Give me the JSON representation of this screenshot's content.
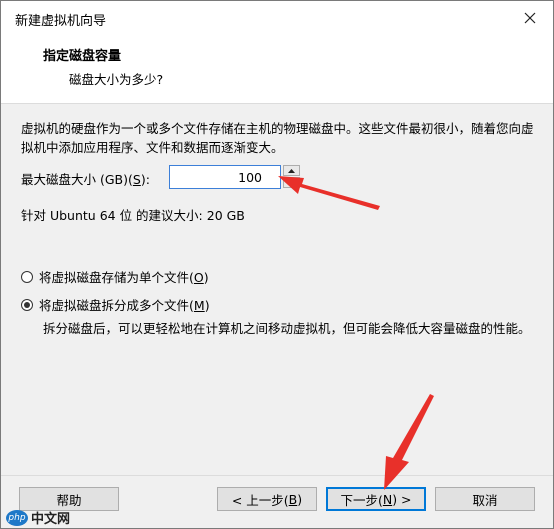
{
  "window": {
    "title": "新建虚拟机向导"
  },
  "header": {
    "title": "指定磁盘容量",
    "subtitle": "磁盘大小为多少?"
  },
  "description": "虚拟机的硬盘作为一个或多个文件存储在主机的物理磁盘中。这些文件最初很小，随着您向虚拟机中添加应用程序、文件和数据而逐渐变大。",
  "disk_size": {
    "label_prefix": "最大磁盘大小 (GB)(",
    "label_key": "S",
    "label_suffix": "):",
    "value": "100"
  },
  "recommend": "针对 Ubuntu 64 位 的建议大小: 20 GB",
  "options": [
    {
      "label_prefix": "将虚拟磁盘存储为单个文件(",
      "key": "O",
      "label_suffix": ")",
      "selected": false
    },
    {
      "label_prefix": "将虚拟磁盘拆分成多个文件(",
      "key": "M",
      "label_suffix": ")",
      "selected": true
    }
  ],
  "split_description": "拆分磁盘后，可以更轻松地在计算机之间移动虚拟机，但可能会降低大容量磁盘的性能。",
  "buttons": {
    "help": "帮助",
    "back_prefix": "< 上一步(",
    "back_key": "B",
    "back_suffix": ")",
    "next_prefix": "下一步(",
    "next_key": "N",
    "next_suffix": ") >",
    "cancel": "取消"
  },
  "watermark": {
    "logo": "php",
    "text": "中文网"
  },
  "colors": {
    "arrow": "#e8302a",
    "focus": "#0078d7"
  },
  "icons": {
    "close": "close-icon",
    "spin_up": "triangle-up-icon",
    "spin_down": "triangle-down-icon"
  }
}
